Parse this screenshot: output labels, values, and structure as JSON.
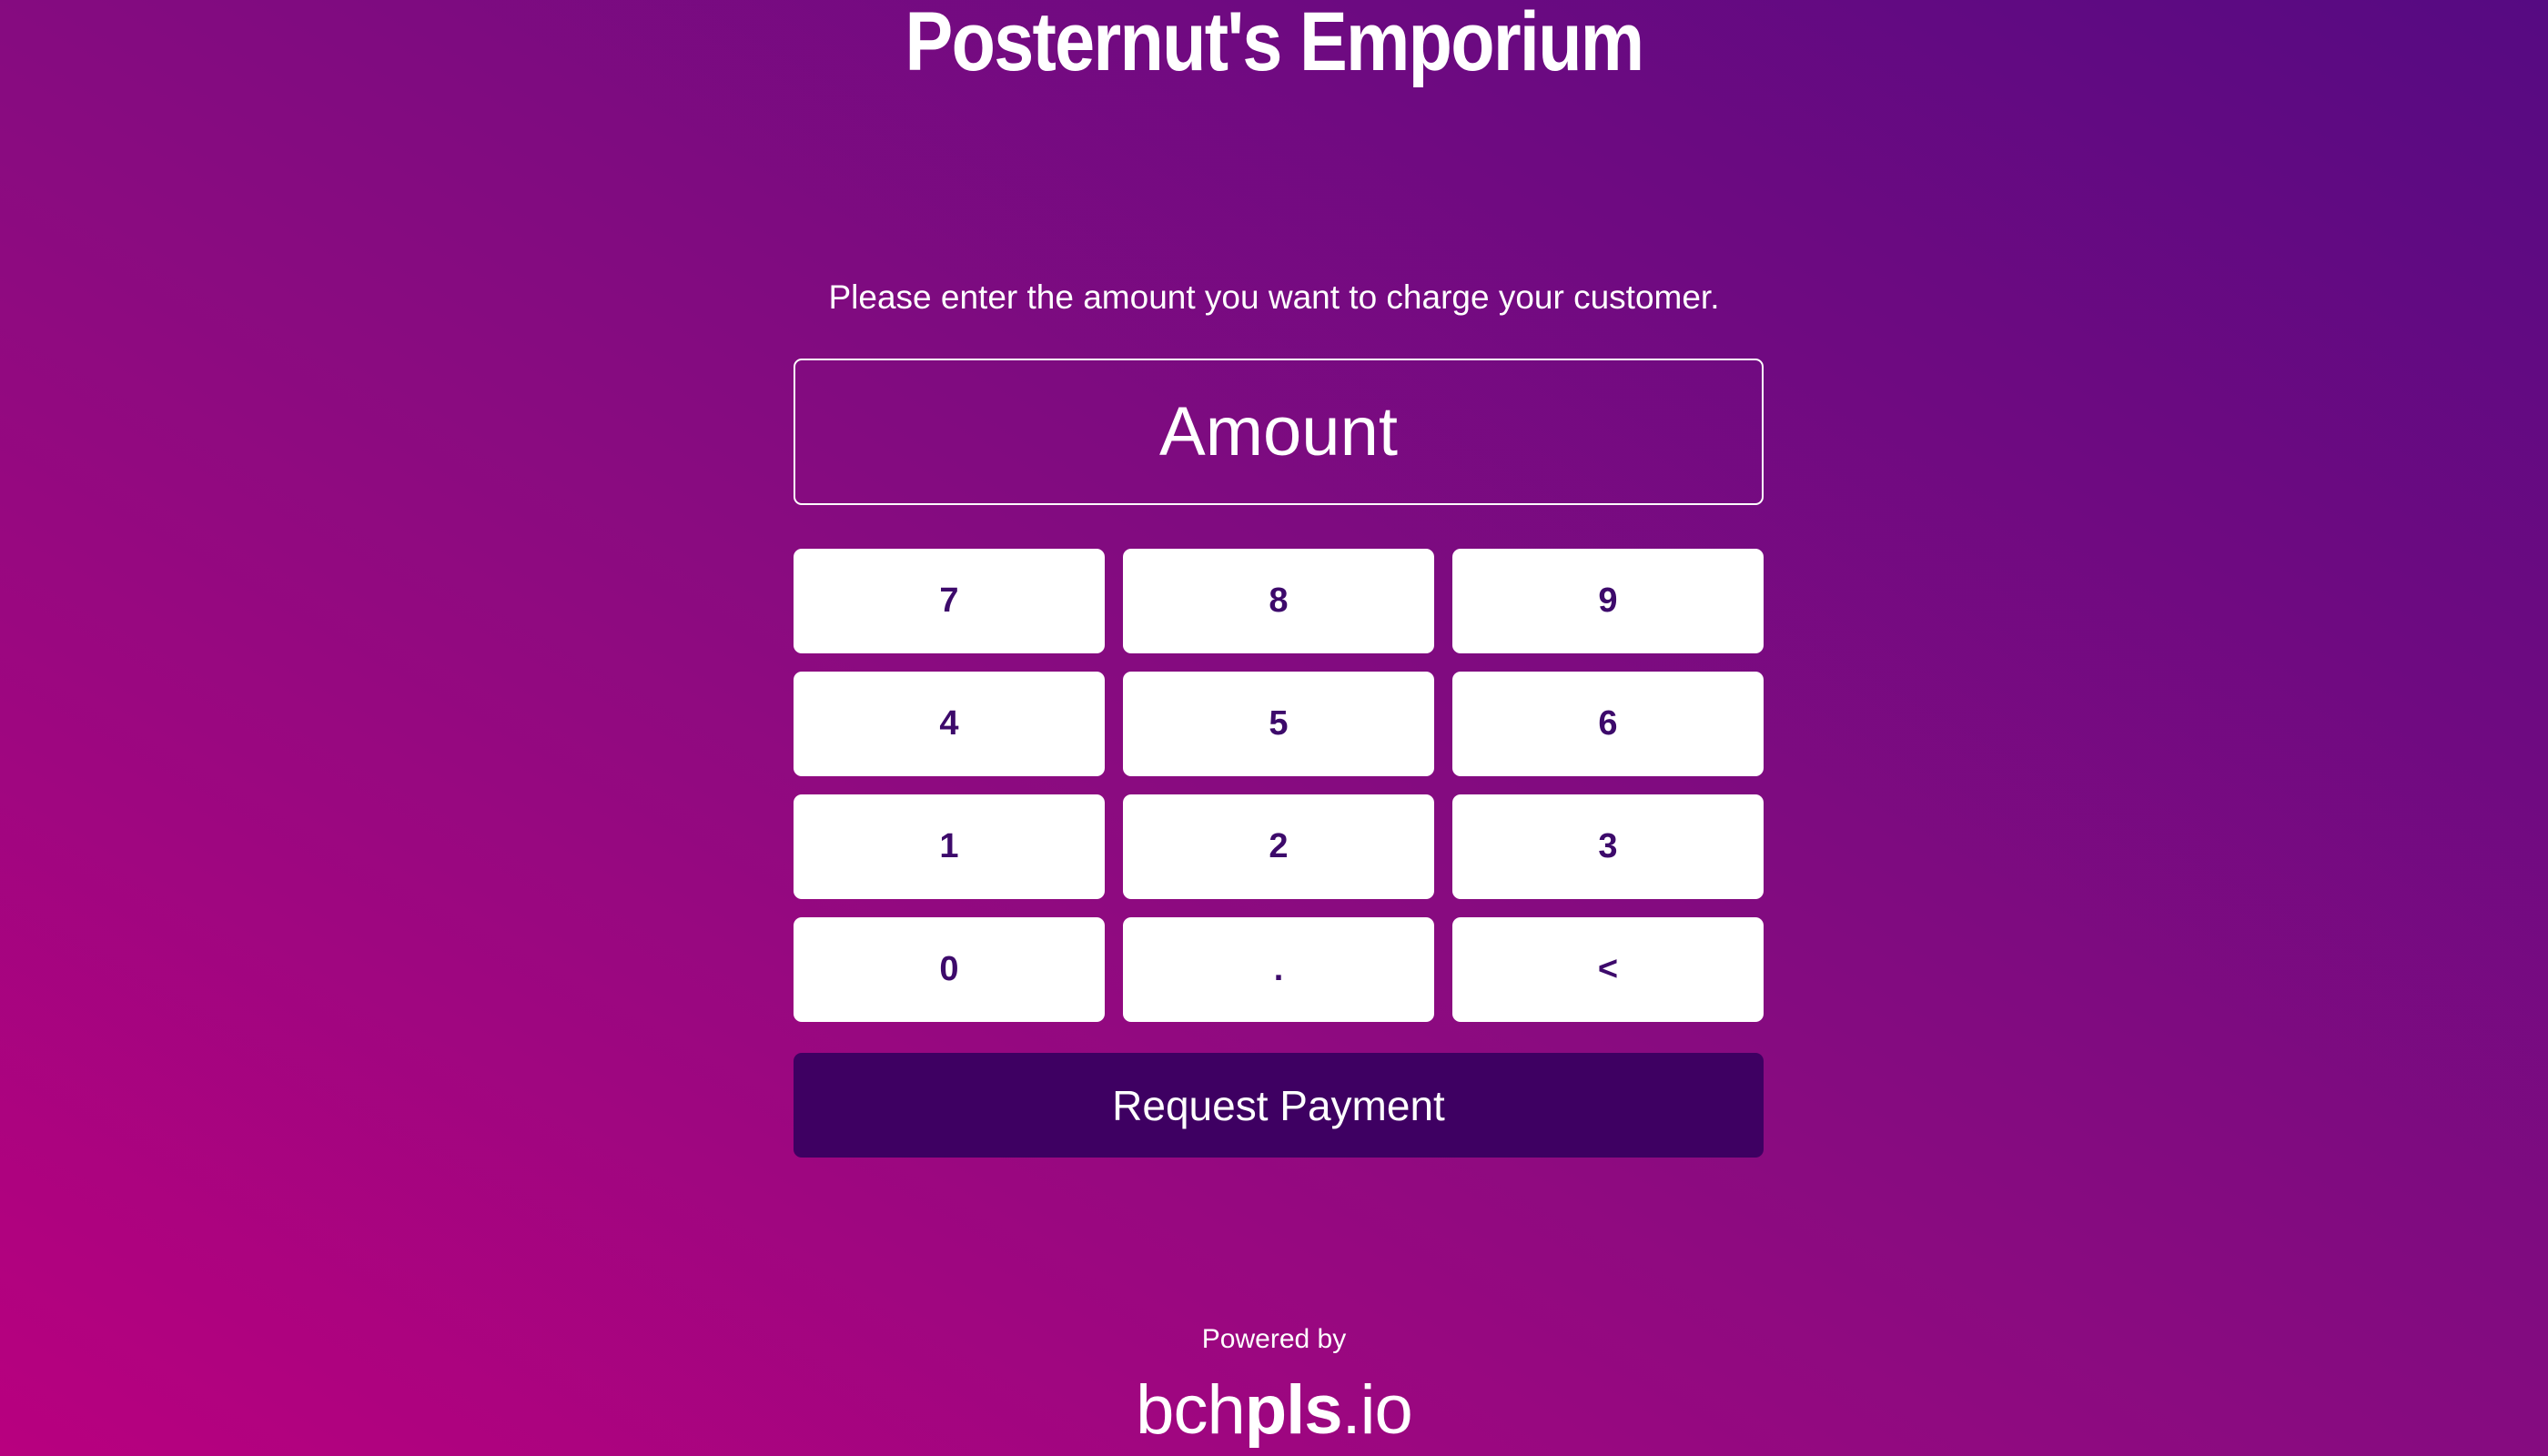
{
  "header": {
    "title": "Posternut's Emporium"
  },
  "main": {
    "instruction": "Please enter the amount you want to charge your customer.",
    "amount_input": {
      "value": "",
      "placeholder": "Amount"
    },
    "keypad": {
      "keys": [
        "7",
        "8",
        "9",
        "4",
        "5",
        "6",
        "1",
        "2",
        "3",
        "0",
        ".",
        "<"
      ]
    },
    "request_button_label": "Request Payment"
  },
  "footer": {
    "powered_by": "Powered by",
    "brand": {
      "prefix": "bch",
      "bold": "pls",
      "suffix": ".io"
    }
  },
  "colors": {
    "background_start": "#b8007f",
    "background_end": "#560a82",
    "key_text": "#3d0a6b",
    "request_button": "#3e0062"
  }
}
